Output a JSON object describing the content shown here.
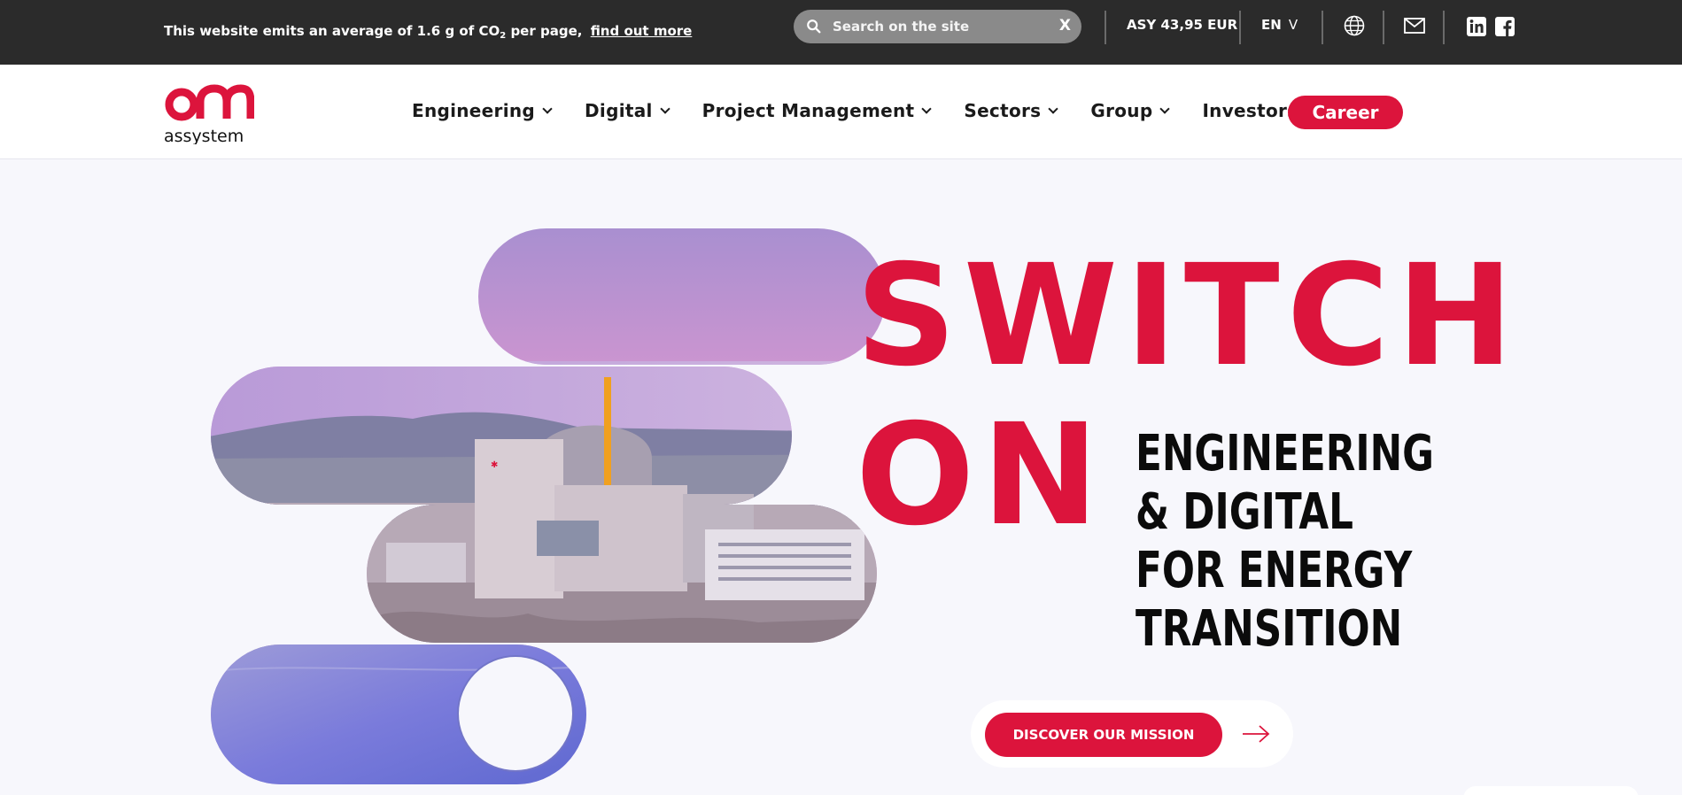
{
  "topbar": {
    "co2_text_before": "This website emits an average of 1.6 g of CO",
    "co2_subscript": "2",
    "co2_text_after": " per page,",
    "co2_link": "find out more",
    "search_placeholder": "Search on the site",
    "search_clear": "X",
    "stock": "ASY 43,95 EUR",
    "language": "EN",
    "language_chevron": "V",
    "icons": [
      "globe-icon",
      "mail-icon",
      "linkedin-icon",
      "facebook-icon"
    ]
  },
  "header": {
    "logo_text": "assystem",
    "nav": [
      {
        "label": "Engineering"
      },
      {
        "label": "Digital"
      },
      {
        "label": "Project Management"
      },
      {
        "label": "Sectors"
      },
      {
        "label": "Group"
      },
      {
        "label": "Investors"
      }
    ],
    "career_label": "Career"
  },
  "hero": {
    "headline_1": "SWITCH",
    "headline_2": "ON",
    "tagline": [
      "ENGINEERING",
      "& DIGITAL",
      "FOR ENERGY",
      "TRANSITION"
    ],
    "cta_label": "DISCOVER OUR MISSION"
  },
  "colors": {
    "brand_red": "#dc143c",
    "topbar_bg": "#2b2b2b",
    "page_bg": "#f7f7fc"
  }
}
